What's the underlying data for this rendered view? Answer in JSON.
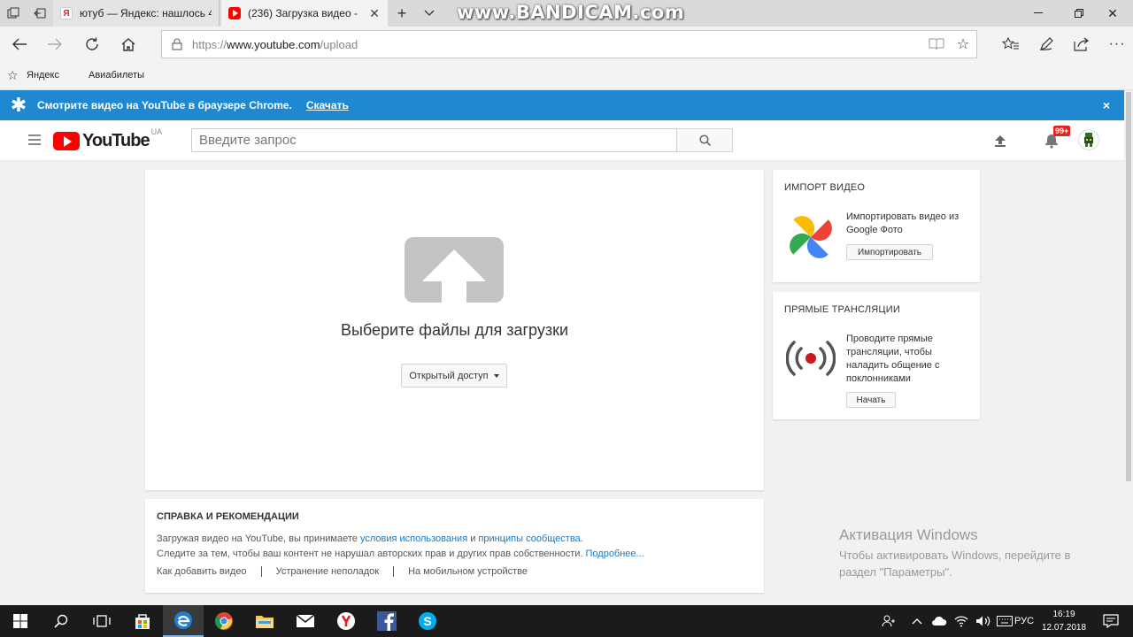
{
  "browser": {
    "watermark": "www.BANDICAM.com",
    "tabs": [
      {
        "label": "ютуб — Яндекс: нашлось 4",
        "favicon": "yandex-icon"
      },
      {
        "label": "(236) Загрузка видео -",
        "favicon": "youtube-icon",
        "active": true
      }
    ],
    "url_prefix": "https://",
    "url_host": "www.youtube.com",
    "url_path": "/upload",
    "favorites": [
      "Яндекс",
      "Авиабилеты"
    ]
  },
  "promo": {
    "text": "Смотрите видео на YouTube в браузере Chrome.",
    "link": "Скачать",
    "close": "×",
    "bg_color": "#1e88d0"
  },
  "youtube": {
    "logo_word": "YouTube",
    "country": "UA",
    "search_placeholder": "Введите запрос",
    "notification_badge": "99+",
    "brand_color": "#ff0000"
  },
  "upload": {
    "title": "Выберите файлы для загрузки",
    "privacy_label": "Открытый доступ"
  },
  "help": {
    "title": "СПРАВКА И РЕКОМЕНДАЦИИ",
    "line1_prefix": "Загружая видео на YouTube, вы принимаете ",
    "line1_link1": "условия использования",
    "line1_and": " и ",
    "line1_link2": "принципы сообщества",
    "line1_suffix": ".",
    "line2_prefix": "Следите за тем, чтобы ваш контент не нарушал авторских прав и других прав собственности. ",
    "line2_link": "Подробнее...",
    "links": [
      "Как добавить видео",
      "Устранение неполадок",
      "На мобильном устройстве"
    ],
    "link_color": "#167ac6"
  },
  "import": {
    "title": "ИМПОРТ ВИДЕО",
    "text": "Импортировать видео из Google Фото",
    "button": "Импортировать"
  },
  "live": {
    "title": "ПРЯМЫЕ ТРАНСЛЯЦИИ",
    "text": "Проводите прямые трансляции, чтобы наладить общение с поклонниками",
    "button": "Начать"
  },
  "activation": {
    "title": "Активация Windows",
    "line1": "Чтобы активировать Windows, перейдите в",
    "line2": "раздел \"Параметры\"."
  },
  "taskbar": {
    "language": "РУС",
    "time": "16:19",
    "date": "12.07.2018"
  }
}
